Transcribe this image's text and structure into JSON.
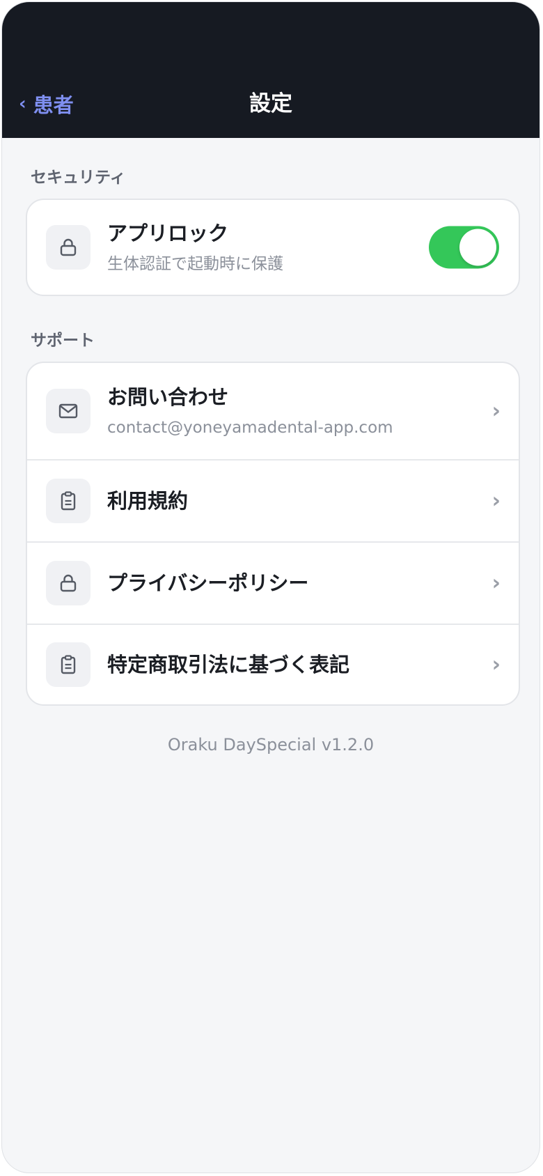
{
  "header": {
    "back_label": "患者",
    "back_chevron": "‹",
    "title": "設定"
  },
  "sections": {
    "security": {
      "label": "セキュリティ",
      "app_lock": {
        "title": "アプリロック",
        "subtitle": "生体認証で起動時に保護",
        "icon": "lock-icon",
        "enabled": true
      }
    },
    "support": {
      "label": "サポート",
      "contact": {
        "title": "お問い合わせ",
        "subtitle": "contact@yoneyamadental-app.com",
        "icon": "mail-icon"
      },
      "terms": {
        "title": "利用規約",
        "icon": "clipboard-icon"
      },
      "privacy": {
        "title": "プライバシーポリシー",
        "icon": "lock-icon"
      },
      "legal": {
        "title": "特定商取引法に基づく表記",
        "icon": "clipboard-icon"
      }
    }
  },
  "chevron": "›",
  "footer": {
    "version": "Oraku DaySpecial v1.2.0"
  },
  "colors": {
    "header_bg": "#161a22",
    "accent": "#7f8ff0",
    "toggle_on": "#34c759",
    "page_bg": "#f5f6f8"
  }
}
